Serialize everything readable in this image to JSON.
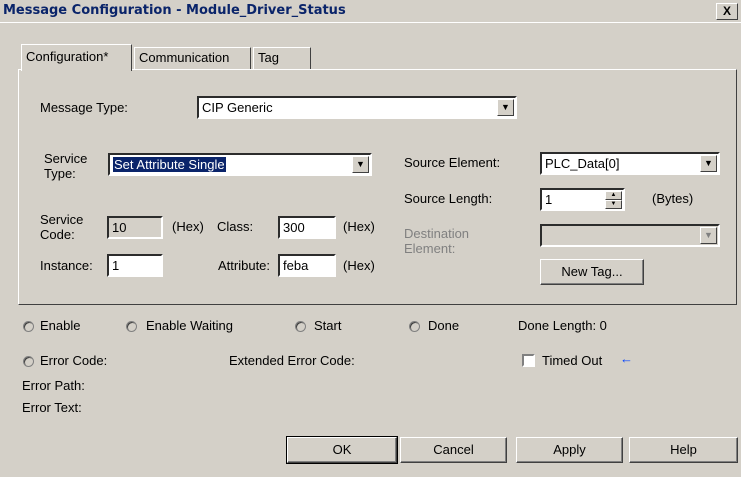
{
  "window": {
    "title": "Message Configuration - Module_Driver_Status",
    "close_label": "X"
  },
  "tabs": [
    {
      "label": "Configuration*",
      "active": true
    },
    {
      "label": "Communication",
      "active": false
    },
    {
      "label": "Tag",
      "active": false
    }
  ],
  "config": {
    "message_type_label": "Message Type:",
    "message_type_value": "CIP Generic",
    "service_type_label_1": "Service",
    "service_type_label_2": "Type:",
    "service_type_value": "Set Attribute Single",
    "service_code_label_1": "Service",
    "service_code_label_2": "Code:",
    "service_code_value": "10",
    "hex_label": "(Hex)",
    "class_label": "Class:",
    "class_value": "300",
    "instance_label": "Instance:",
    "instance_value": "1",
    "attribute_label": "Attribute:",
    "attribute_value": "feba",
    "source_element_label": "Source Element:",
    "source_element_value": "PLC_Data[0]",
    "source_length_label": "Source Length:",
    "source_length_value": "1",
    "bytes_label": "(Bytes)",
    "destination_label_1": "Destination",
    "destination_label_2": "Element:",
    "destination_value": "",
    "new_tag_label": "New Tag..."
  },
  "status": {
    "enable_label": "Enable",
    "enable_waiting_label": "Enable Waiting",
    "start_label": "Start",
    "done_label": "Done",
    "done_length_label": "Done Length: 0",
    "error_code_label": "Error Code:",
    "extended_error_code_label": "Extended Error Code:",
    "timed_out_label": "Timed Out",
    "timed_out_arrow": "←",
    "error_path_label": "Error Path:",
    "error_text_label": "Error Text:"
  },
  "buttons": {
    "ok": "OK",
    "cancel": "Cancel",
    "apply": "Apply",
    "help": "Help"
  },
  "colors": {
    "background": "#d4d0c8",
    "title_text": "#0a246a",
    "selection": "#0a246a",
    "arrow": "#0040ff"
  }
}
